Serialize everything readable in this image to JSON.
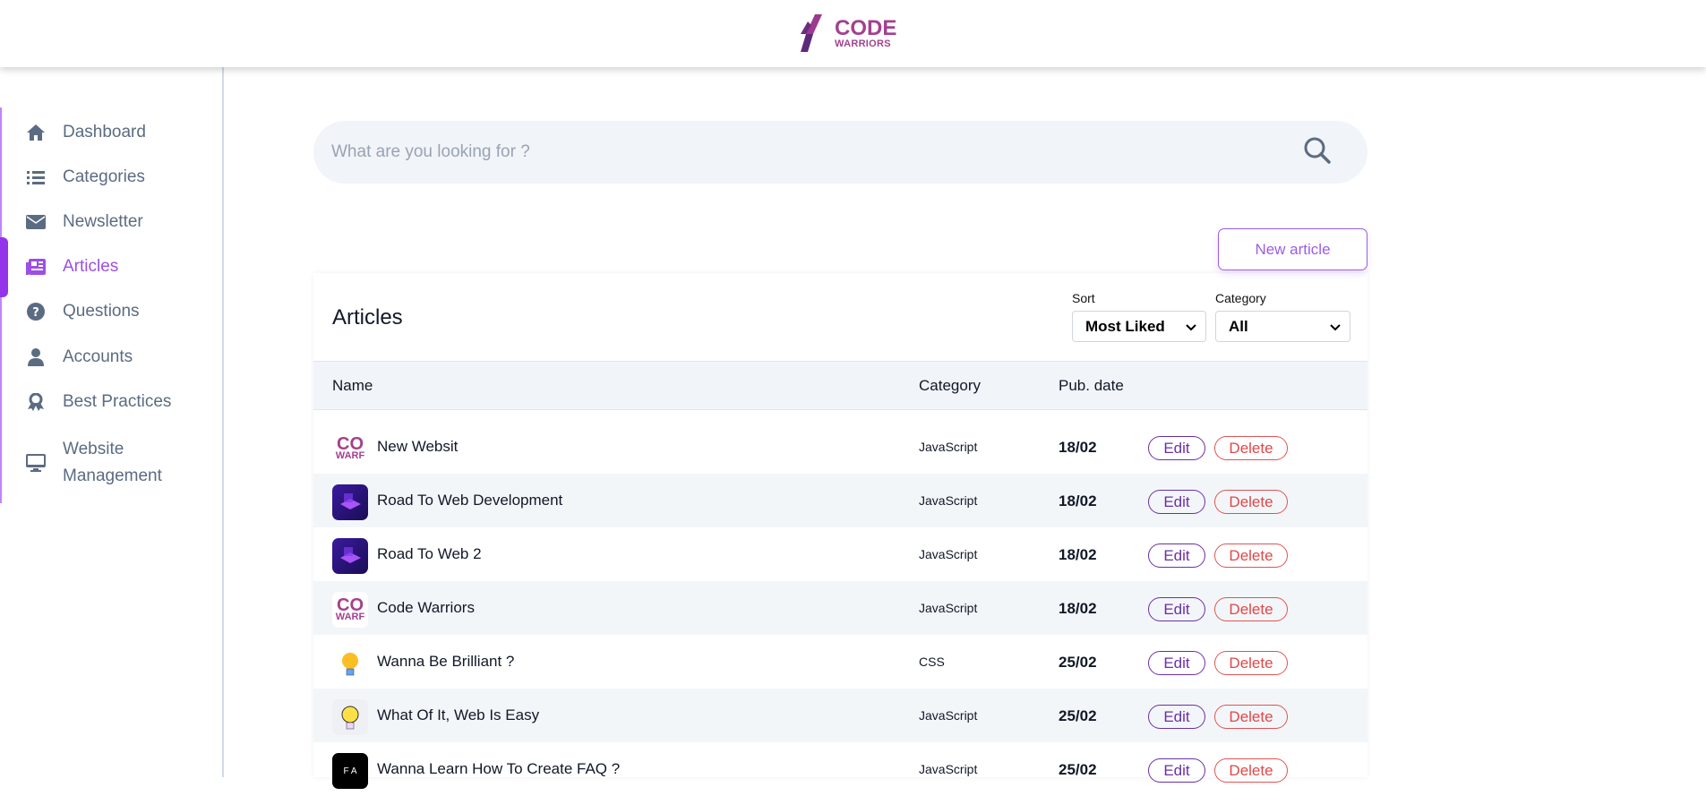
{
  "brand": {
    "line1": "CODE",
    "line2": "WARRIORS",
    "color": "#a3418f"
  },
  "sidebar": {
    "items": [
      {
        "label": "Dashboard",
        "icon": "home-icon"
      },
      {
        "label": "Categories",
        "icon": "list-icon"
      },
      {
        "label": "Newsletter",
        "icon": "envelope-icon"
      },
      {
        "label": "Articles",
        "icon": "newspaper-icon",
        "active": true
      },
      {
        "label": "Questions",
        "icon": "question-circle-icon"
      },
      {
        "label": "Accounts",
        "icon": "user-icon"
      },
      {
        "label": "Best Practices",
        "icon": "award-icon"
      },
      {
        "label": "Website",
        "label2": "Management",
        "icon": "desktop-icon"
      }
    ]
  },
  "search": {
    "placeholder": "What are you looking for ?"
  },
  "new_article_label": "New article",
  "articles": {
    "title": "Articles",
    "sort_label": "Sort",
    "sort_value": "Most Liked",
    "category_label": "Category",
    "category_value": "All",
    "columns": [
      "Name",
      "Category",
      "Pub. date"
    ],
    "edit_label": "Edit",
    "delete_label": "Delete",
    "rows": [
      {
        "name": "New Websit",
        "category": "JavaScript",
        "date": "18/02",
        "thumb": "cw",
        "thumb_text": "CO",
        "thumb_text2": "WARF"
      },
      {
        "name": "Road To Web Development",
        "category": "JavaScript",
        "date": "18/02",
        "thumb": "road"
      },
      {
        "name": "Road To Web 2",
        "category": "JavaScript",
        "date": "18/02",
        "thumb": "road"
      },
      {
        "name": "Code Warriors",
        "category": "JavaScript",
        "date": "18/02",
        "thumb": "cw",
        "thumb_text": "CO",
        "thumb_text2": "WARF"
      },
      {
        "name": "Wanna Be Brilliant ?",
        "category": "CSS",
        "date": "25/02",
        "thumb": "bulb"
      },
      {
        "name": "What Of It, Web Is Easy",
        "category": "JavaScript",
        "date": "25/02",
        "thumb": "bulb2"
      },
      {
        "name": "Wanna Learn How To Create FAQ ?",
        "category": "JavaScript",
        "date": "25/02",
        "thumb": "faq",
        "thumb_text": "F A"
      }
    ]
  },
  "colors": {
    "accent": "#9b4fe6",
    "edit": "#6b2fa6",
    "delete": "#e04848"
  }
}
